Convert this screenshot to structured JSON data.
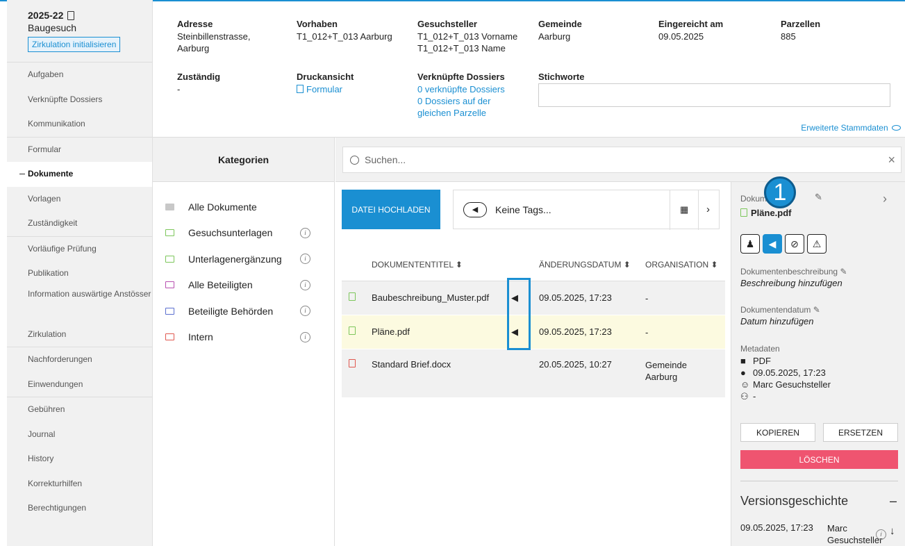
{
  "sidebar": {
    "title": "2025-22",
    "subtitle": "Baugesuch",
    "action": "Zirkulation initialisieren",
    "groups": [
      [
        "Aufgaben",
        "Verknüpfte Dossiers",
        "Kommunikation"
      ],
      [
        "Formular",
        "Dokumente",
        "Vorlagen",
        "Zuständigkeit"
      ],
      [
        "Vorläufige Prüfung",
        "Publikation",
        "Information auswärtige Anstösser",
        "Zirkulation"
      ],
      [
        "Nachforderungen",
        "Einwendungen"
      ],
      [
        "Gebühren",
        "Journal",
        "History",
        "Korrekturhilfen",
        "Berechtigungen"
      ]
    ],
    "active": "Dokumente"
  },
  "header": {
    "adresse": {
      "label": "Adresse",
      "value": "Steinbillenstrasse, Aarburg"
    },
    "vorhaben": {
      "label": "Vorhaben",
      "value": "T1_012+T_013 Aarburg"
    },
    "gesuchsteller": {
      "label": "Gesuchsteller",
      "value": "T1_012+T_013 Vorname T1_012+T_013 Name"
    },
    "gemeinde": {
      "label": "Gemeinde",
      "value": "Aarburg"
    },
    "eingereicht": {
      "label": "Eingereicht am",
      "value": "09.05.2025"
    },
    "parzellen": {
      "label": "Parzellen",
      "value": "885"
    },
    "zustaendig": {
      "label": "Zuständig",
      "value": "-"
    },
    "druckansicht": {
      "label": "Druckansicht",
      "value": "Formular"
    },
    "verknuepft": {
      "label": "Verknüpfte Dossiers",
      "line1": "0 verknüpfte Dossiers",
      "line2": "0 Dossiers auf der gleichen Parzelle"
    },
    "stichworte": {
      "label": "Stichworte"
    },
    "erweitert": "Erweiterte Stammdaten"
  },
  "categories": {
    "title": "Kategorien",
    "items": [
      {
        "label": "Alle Dokumente",
        "color": "#c8c8c8",
        "info": false
      },
      {
        "label": "Gesuchsunterlagen",
        "color": "#7cc65a",
        "info": true
      },
      {
        "label": "Unterlagenergänzung",
        "color": "#7cc65a",
        "info": true
      },
      {
        "label": "Alle Beteiligten",
        "color": "#b84fb0",
        "info": true
      },
      {
        "label": "Beteiligte Behörden",
        "color": "#5b6fcf",
        "info": true
      },
      {
        "label": "Intern",
        "color": "#e0584f",
        "info": true
      }
    ]
  },
  "search": {
    "placeholder": "Suchen..."
  },
  "toolbar": {
    "upload": "DATEI HOCHLADEN",
    "tags": "Keine Tags..."
  },
  "table": {
    "columns": [
      "DOKUMENTENTITEL",
      "ÄNDERUNGSDATUM",
      "ORGANISATION"
    ],
    "rows": [
      {
        "title": "Baubeschreibung_Muster.pdf",
        "date": "09.05.2025, 17:23",
        "org": "-",
        "color": "#7cc65a",
        "tag": true
      },
      {
        "title": "Pläne.pdf",
        "date": "09.05.2025, 17:23",
        "org": "-",
        "color": "#7cc65a",
        "tag": true
      },
      {
        "title": "Standard Brief.docx",
        "date": "20.05.2025, 10:27",
        "org": "Gemeinde Aarburg",
        "color": "#e0584f",
        "tag": false
      }
    ]
  },
  "panel": {
    "doc_label": "Dokum",
    "doc_name": "Pläne.pdf",
    "desc_label": "Dokumentenbeschreibung",
    "desc_value": "Beschreibung hinzufügen",
    "date_label": "Dokumentendatum",
    "date_value": "Datum hinzufügen",
    "meta_label": "Metadaten",
    "meta_type": "PDF",
    "meta_date": "09.05.2025, 17:23",
    "meta_user": "Marc Gesuchsteller",
    "meta_group": "-",
    "copy": "KOPIEREN",
    "replace": "ERSETZEN",
    "delete": "LÖSCHEN",
    "version_title": "Versionsgeschichte",
    "version_date": "09.05.2025, 17:23",
    "version_user": "Marc Gesuchsteller"
  },
  "badge": "1",
  "colors": {
    "accent": "#1a8fd2",
    "danger": "#ef5470",
    "selected_row": "#fcfae0"
  }
}
